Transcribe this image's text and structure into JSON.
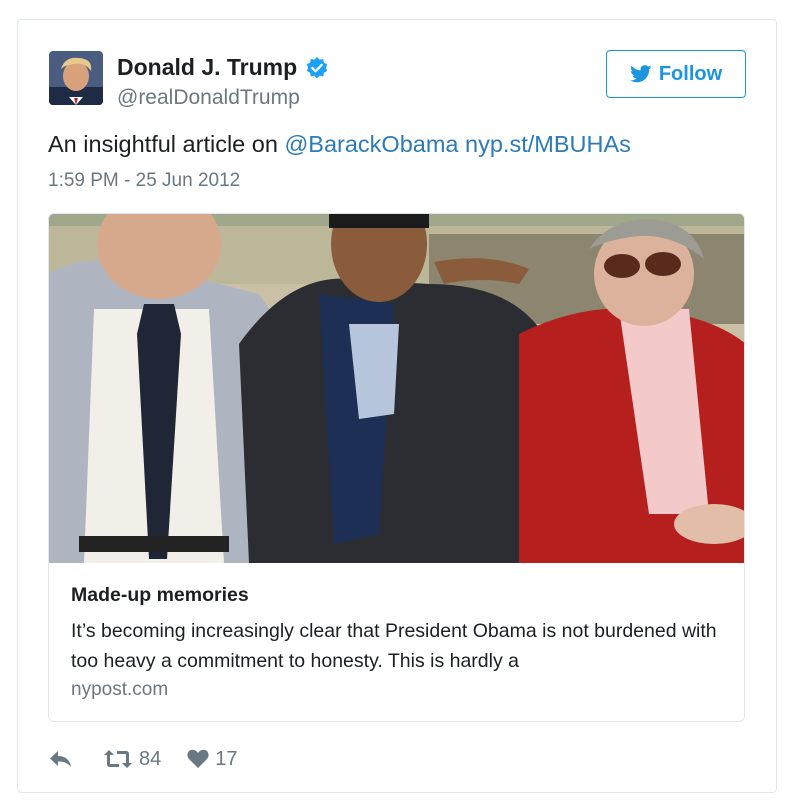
{
  "tweet": {
    "display_name": "Donald J. Trump",
    "screen_name": "@realDonaldTrump",
    "follow_label": "Follow",
    "text_prefix": "An insightful article on ",
    "mention": "@BarackObama",
    "link": "nyp.st/MBUHAs",
    "timestamp": "1:59 PM - 25 Jun 2012"
  },
  "card": {
    "title": "Made-up memories",
    "description": "It’s becoming increasingly clear that President Obama is not burdened with too heavy a commitment to honesty. This is hardly a",
    "domain": "nypost.com"
  },
  "actions": {
    "retweet_count": "84",
    "like_count": "17"
  },
  "colors": {
    "link": "#2b7bb9",
    "follow_blue": "#1b95e0",
    "meta_gray": "#697882",
    "border": "#e1e8ed"
  },
  "icons": {
    "verified": "verified-badge-icon",
    "follow": "twitter-bird-icon",
    "reply": "reply-arrow-icon",
    "retweet": "retweet-icon",
    "like": "heart-icon"
  }
}
